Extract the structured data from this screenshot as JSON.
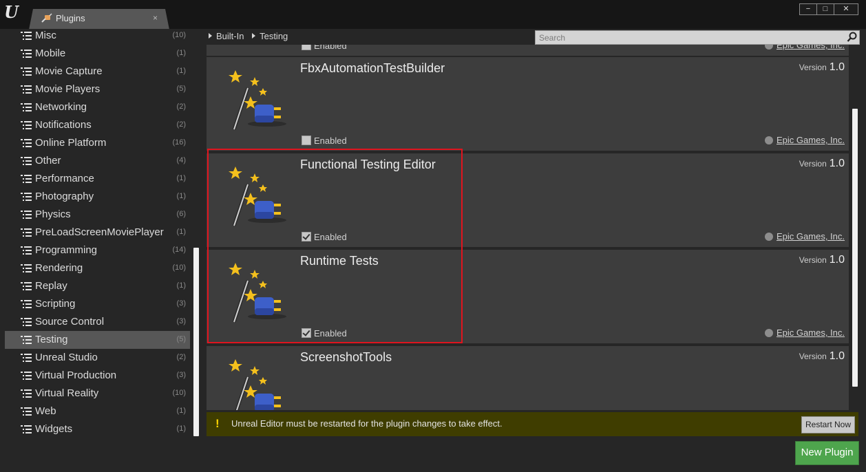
{
  "window": {
    "tab_title": "Plugins",
    "tab_close": "×",
    "minimize": "−",
    "maximize": "□",
    "close": "✕"
  },
  "sidebar": {
    "categories": [
      {
        "label": "Misc",
        "count": "(10)",
        "selected": false
      },
      {
        "label": "Mobile",
        "count": "(1)",
        "selected": false
      },
      {
        "label": "Movie Capture",
        "count": "(1)",
        "selected": false
      },
      {
        "label": "Movie Players",
        "count": "(5)",
        "selected": false
      },
      {
        "label": "Networking",
        "count": "(2)",
        "selected": false
      },
      {
        "label": "Notifications",
        "count": "(2)",
        "selected": false
      },
      {
        "label": "Online Platform",
        "count": "(16)",
        "selected": false
      },
      {
        "label": "Other",
        "count": "(4)",
        "selected": false
      },
      {
        "label": "Performance",
        "count": "(1)",
        "selected": false
      },
      {
        "label": "Photography",
        "count": "(1)",
        "selected": false
      },
      {
        "label": "Physics",
        "count": "(6)",
        "selected": false
      },
      {
        "label": "PreLoadScreenMoviePlayer",
        "count": "(1)",
        "selected": false
      },
      {
        "label": "Programming",
        "count": "(14)",
        "selected": false
      },
      {
        "label": "Rendering",
        "count": "(10)",
        "selected": false
      },
      {
        "label": "Replay",
        "count": "(1)",
        "selected": false
      },
      {
        "label": "Scripting",
        "count": "(3)",
        "selected": false
      },
      {
        "label": "Source Control",
        "count": "(3)",
        "selected": false
      },
      {
        "label": "Testing",
        "count": "(5)",
        "selected": true
      },
      {
        "label": "Unreal Studio",
        "count": "(2)",
        "selected": false
      },
      {
        "label": "Virtual Production",
        "count": "(3)",
        "selected": false
      },
      {
        "label": "Virtual Reality",
        "count": "(10)",
        "selected": false
      },
      {
        "label": "Web",
        "count": "(1)",
        "selected": false
      },
      {
        "label": "Widgets",
        "count": "(1)",
        "selected": false
      }
    ]
  },
  "breadcrumb": {
    "items": [
      "Built-In",
      "Testing"
    ]
  },
  "search": {
    "placeholder": "Search"
  },
  "plugins": [
    {
      "title": "",
      "version_label": "",
      "version": "",
      "enabled_label": "Enabled",
      "enabled": false,
      "vendor": "Epic Games, Inc."
    },
    {
      "title": "FbxAutomationTestBuilder",
      "version_label": "Version",
      "version": "1.0",
      "enabled_label": "Enabled",
      "enabled": false,
      "vendor": "Epic Games, Inc."
    },
    {
      "title": "Functional Testing Editor",
      "version_label": "Version",
      "version": "1.0",
      "enabled_label": "Enabled",
      "enabled": true,
      "vendor": "Epic Games, Inc."
    },
    {
      "title": "Runtime Tests",
      "version_label": "Version",
      "version": "1.0",
      "enabled_label": "Enabled",
      "enabled": true,
      "vendor": "Epic Games, Inc."
    },
    {
      "title": "ScreenshotTools",
      "version_label": "Version",
      "version": "1.0",
      "enabled_label": "",
      "enabled": false,
      "vendor": ""
    }
  ],
  "notice": {
    "icon": "!",
    "text": "Unreal Editor must be restarted for the plugin changes to take effect.",
    "restart_label": "Restart Now"
  },
  "new_plugin_label": "New Plugin",
  "colors": {
    "accent_green": "#4ea54d",
    "highlight_red": "#e0141e",
    "notice_bg": "#3f3d00",
    "selected_row": "#575757"
  }
}
